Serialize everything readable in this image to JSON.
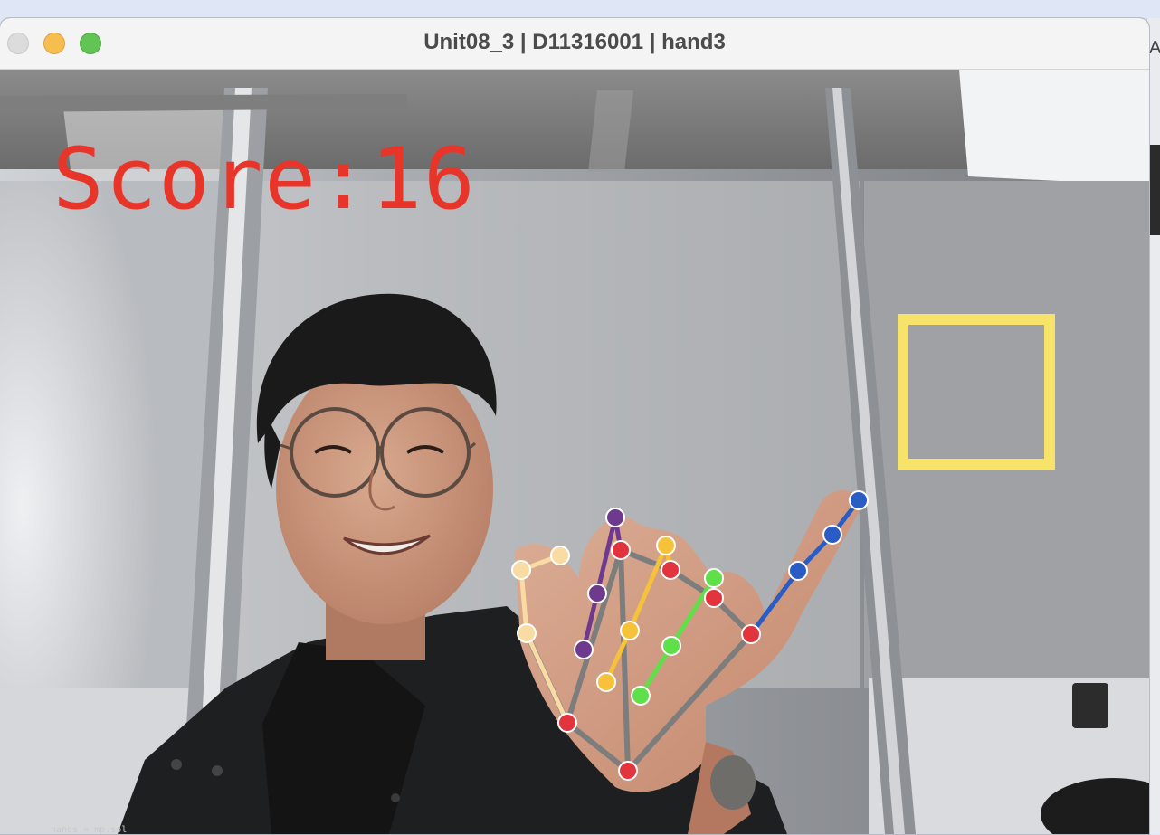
{
  "window": {
    "title": "Unit08_3 | D11316001 | hand3"
  },
  "overlay": {
    "score_text": "Score:16",
    "score_color": "#e8352a",
    "target_box_color": "#f7e36a"
  },
  "desktop": {
    "right_edge_glyph": "A",
    "bottom_code_fragment": "hands = mp.sol"
  },
  "icons": {
    "close": "close-button-icon",
    "minimize": "minimize-button-icon",
    "maximize": "zoom-button-icon"
  },
  "hand_colors": {
    "thumb": "#2a5cc6",
    "index": "#5fe04a",
    "middle": "#f5c23a",
    "ring": "#6f3a8e",
    "pinky": "#f8dca3",
    "palm": "#e2343c",
    "bone": "#7d7d7d"
  }
}
